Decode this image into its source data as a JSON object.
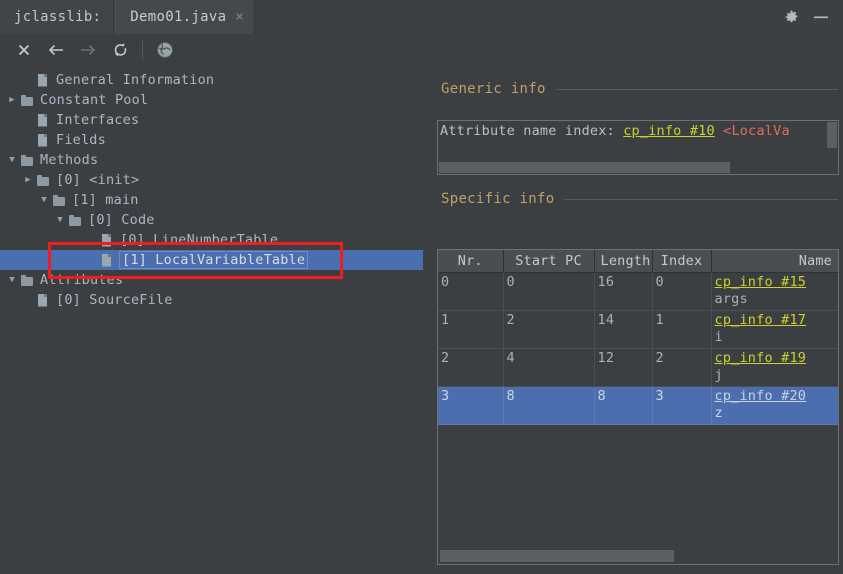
{
  "window": {
    "brand_label": "jclasslib:",
    "tab_label": "Demo01.java",
    "tab_close_glyph": "×",
    "settings_icon": "gear-icon",
    "minimize_icon": "minimize-icon"
  },
  "toolbar": {
    "items": [
      {
        "name": "close-icon",
        "glyph": "✕",
        "dim": false
      },
      {
        "name": "back-icon",
        "glyph": "←",
        "dim": false
      },
      {
        "name": "forward-icon",
        "glyph": "→",
        "dim": true
      },
      {
        "name": "reload-icon",
        "glyph": "↻",
        "dim": false
      },
      {
        "name": "browse-icon",
        "glyph": "●",
        "dim": false
      }
    ]
  },
  "tree": {
    "rows": [
      {
        "indent": 1,
        "twisty": "none",
        "icon": "file",
        "label": "General Information"
      },
      {
        "indent": 0,
        "twisty": "closed",
        "icon": "folder",
        "label": "Constant Pool"
      },
      {
        "indent": 1,
        "twisty": "none",
        "icon": "file",
        "label": "Interfaces"
      },
      {
        "indent": 1,
        "twisty": "none",
        "icon": "file",
        "label": "Fields"
      },
      {
        "indent": 0,
        "twisty": "open",
        "icon": "folder",
        "label": "Methods"
      },
      {
        "indent": 1,
        "twisty": "closed",
        "icon": "folder",
        "label": "[0] <init>"
      },
      {
        "indent": 2,
        "twisty": "open",
        "icon": "folder",
        "label": "[1] main"
      },
      {
        "indent": 3,
        "twisty": "open",
        "icon": "folder",
        "label": "[0] Code"
      },
      {
        "indent": 5,
        "twisty": "none",
        "icon": "file",
        "label": "[0] LineNumberTable"
      },
      {
        "indent": 5,
        "twisty": "none",
        "icon": "file",
        "label": "[1] LocalVariableTable",
        "selected": true
      },
      {
        "indent": 0,
        "twisty": "open",
        "icon": "folder",
        "label": "Attributes"
      },
      {
        "indent": 1,
        "twisty": "none",
        "icon": "file",
        "label": "[0] SourceFile"
      }
    ],
    "highlight_annotation": "red-rectangle-around-localvariabletable"
  },
  "generic_info": {
    "title": "Generic info",
    "line_label": "Attribute name index:",
    "line_link": "cp_info #10",
    "line_value": "<LocalVa"
  },
  "specific_info": {
    "title": "Specific info",
    "columns": [
      "Nr.",
      "Start PC",
      "Length",
      "Index",
      "Name"
    ],
    "rows": [
      {
        "nr": "0",
        "start_pc": "0",
        "length": "16",
        "index": "0",
        "name_link": "cp_info #15",
        "name_value": "args",
        "selected": false
      },
      {
        "nr": "1",
        "start_pc": "2",
        "length": "14",
        "index": "1",
        "name_link": "cp_info #17",
        "name_value": "i",
        "selected": false
      },
      {
        "nr": "2",
        "start_pc": "4",
        "length": "12",
        "index": "2",
        "name_link": "cp_info #19",
        "name_value": "j",
        "selected": false
      },
      {
        "nr": "3",
        "start_pc": "8",
        "length": "8",
        "index": "3",
        "name_link": "cp_info #20",
        "name_value": "z",
        "selected": true
      }
    ]
  },
  "colors": {
    "background": "#3c3f41",
    "selection": "#4b6eaf",
    "link": "#c9d22c",
    "section_title": "#c0a06b",
    "annotation": "#ef1d1d",
    "value_text": "#e06c5e"
  }
}
